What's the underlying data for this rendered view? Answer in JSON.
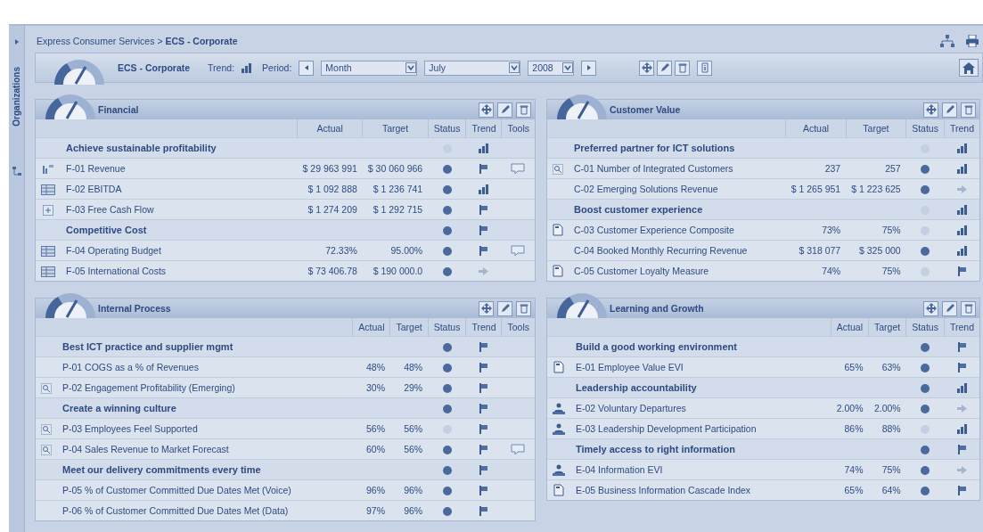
{
  "side_tab": {
    "label": "Organizations"
  },
  "breadcrumb": "Express Consumer Services > **ECS - Corporate**",
  "toolbar": {
    "title": "ECS - Corporate",
    "trend_label": "Trend:",
    "trend": {
      "kind": "up"
    },
    "period_label": "Period:",
    "selects": [
      "Month",
      "July",
      "2008"
    ]
  },
  "panels": [
    {
      "title": "Financial",
      "columns": [
        "Actual",
        "Target",
        "Status",
        "Trend",
        "Tools"
      ],
      "rows": [
        {
          "kind": "objective",
          "name": "Achieve sustainable profitability",
          "status": {
            "color": "#c3cfe2"
          },
          "trend": {
            "kind": "up"
          }
        },
        {
          "kind": "measure",
          "icon": {
            "kind": "chart"
          },
          "name": "F-01 Revenue",
          "actual": "$ 29 963 991",
          "target": "$ 30 060 966",
          "status": {
            "color": "#4a6a9e"
          },
          "trend": {
            "kind": "down"
          },
          "comment": true
        },
        {
          "kind": "measure",
          "icon": {
            "kind": "table"
          },
          "name": "F-02 EBITDA",
          "actual": "$ 1 092 888",
          "target": "$ 1 236 741",
          "status": {
            "color": "#4a6a9e"
          },
          "trend": {
            "kind": "up"
          },
          "comment": false
        },
        {
          "kind": "measure",
          "icon": {
            "kind": "plus"
          },
          "name": "F-03 Free Cash Flow",
          "actual": "$ 1 274 209",
          "target": "$ 1 292 715",
          "status": {
            "color": "#4a6a9e"
          },
          "trend": {
            "kind": "down"
          },
          "comment": false
        },
        {
          "kind": "objective",
          "name": "Competitive Cost",
          "status": {
            "color": "#4a6a9e"
          },
          "trend": {
            "kind": "down"
          }
        },
        {
          "kind": "measure",
          "icon": {
            "kind": "table"
          },
          "name": "F-04 Operating Budget",
          "actual": "72.33%",
          "target": "95.00%",
          "status": {
            "color": "#4a6a9e"
          },
          "trend": {
            "kind": "down"
          },
          "comment": true
        },
        {
          "kind": "measure",
          "icon": {
            "kind": "table"
          },
          "name": "F-05 International Costs",
          "actual": "$ 73 406.78",
          "target": "$ 190 000.0",
          "status": {
            "color": "#4a6a9e"
          },
          "trend": {
            "kind": "flat"
          },
          "comment": false
        }
      ]
    },
    {
      "title": "Customer Value",
      "columns": [
        "Actual",
        "Target",
        "Status",
        "Trend"
      ],
      "rows": [
        {
          "kind": "objective",
          "name": "Preferred partner for ICT solutions",
          "status": {
            "color": "#c3cfe2"
          },
          "trend": {
            "kind": "up"
          }
        },
        {
          "kind": "measure",
          "icon": {
            "kind": "magnifier"
          },
          "name": "C-01 Number of Integrated Customers",
          "actual": "237",
          "target": "257",
          "status": {
            "color": "#4a6a9e"
          },
          "trend": {
            "kind": "up"
          }
        },
        {
          "kind": "measure",
          "name": "C-02 Emerging Solutions Revenue",
          "actual": "$ 1 265 951",
          "target": "$ 1 223 625",
          "status": {
            "color": "#4a6a9e"
          },
          "trend": {
            "kind": "flat"
          }
        },
        {
          "kind": "objective",
          "name": "Boost customer experience",
          "status": {
            "color": "#c3cfe2"
          },
          "trend": {
            "kind": "up"
          }
        },
        {
          "kind": "measure",
          "icon": {
            "kind": "doc"
          },
          "name": "C-03 Customer Experience Composite",
          "actual": "73%",
          "target": "75%",
          "status": {
            "color": "#c3cfe2"
          },
          "trend": {
            "kind": "up"
          }
        },
        {
          "kind": "measure",
          "name": "C-04 Booked Monthly Recurring Revenue",
          "actual": "$ 318 077",
          "target": "$ 325 000",
          "status": {
            "color": "#4a6a9e"
          },
          "trend": {
            "kind": "up"
          }
        },
        {
          "kind": "measure",
          "icon": {
            "kind": "doc"
          },
          "name": "C-05 Customer Loyalty Measure",
          "actual": "74%",
          "target": "75%",
          "status": {
            "color": "#c3cfe2"
          },
          "trend": {
            "kind": "down"
          }
        }
      ]
    },
    {
      "title": "Internal Process",
      "columns": [
        "Actual",
        "Target",
        "Status",
        "Trend",
        "Tools"
      ],
      "rows": [
        {
          "kind": "objective",
          "name": "Best ICT practice and supplier mgmt",
          "status": {
            "color": "#4a6a9e"
          },
          "trend": {
            "kind": "down"
          }
        },
        {
          "kind": "measure",
          "name": "P-01 COGS as a % of Revenues",
          "actual": "48%",
          "target": "48%",
          "status": {
            "color": "#4a6a9e"
          },
          "trend": {
            "kind": "down"
          },
          "comment": false
        },
        {
          "kind": "measure",
          "icon": {
            "kind": "magnifier"
          },
          "name": "P-02 Engagement Profitability (Emerging)",
          "actual": "30%",
          "target": "29%",
          "status": {
            "color": "#4a6a9e"
          },
          "trend": {
            "kind": "down"
          },
          "comment": false
        },
        {
          "kind": "objective",
          "name": "Create a winning culture",
          "status": {
            "color": "#4a6a9e"
          },
          "trend": {
            "kind": "down"
          }
        },
        {
          "kind": "measure",
          "icon": {
            "kind": "magnifier"
          },
          "name": "P-03 Employees Feel Supported",
          "actual": "56%",
          "target": "56%",
          "status": {
            "color": "#c3cfe2"
          },
          "trend": {
            "kind": "down"
          },
          "comment": false
        },
        {
          "kind": "measure",
          "icon": {
            "kind": "magnifier"
          },
          "name": "P-04 Sales Revenue to Market Forecast",
          "actual": "60%",
          "target": "56%",
          "status": {
            "color": "#4a6a9e"
          },
          "trend": {
            "kind": "down"
          },
          "comment": true
        },
        {
          "kind": "objective",
          "name": "Meet our delivery commitments every time",
          "status": {
            "color": "#4a6a9e"
          },
          "trend": {
            "kind": "down"
          }
        },
        {
          "kind": "measure",
          "name": "P-05 % of Customer Committed Due Dates Met (Voice)",
          "actual": "96%",
          "target": "96%",
          "status": {
            "color": "#4a6a9e"
          },
          "trend": {
            "kind": "down"
          },
          "comment": false
        },
        {
          "kind": "measure",
          "name": "P-06 % of Customer Committed Due Dates Met (Data)",
          "actual": "97%",
          "target": "96%",
          "status": {
            "color": "#4a6a9e"
          },
          "trend": {
            "kind": "down"
          },
          "comment": false
        }
      ]
    },
    {
      "title": "Learning and Growth",
      "columns": [
        "Actual",
        "Target",
        "Status",
        "Trend"
      ],
      "rows": [
        {
          "kind": "objective",
          "name": "Build a good working environment",
          "status": {
            "color": "#4a6a9e"
          },
          "trend": {
            "kind": "down"
          }
        },
        {
          "kind": "measure",
          "icon": {
            "kind": "doc"
          },
          "name": "E-01 Employee Value EVI",
          "actual": "65%",
          "target": "63%",
          "status": {
            "color": "#4a6a9e"
          },
          "trend": {
            "kind": "down"
          }
        },
        {
          "kind": "objective",
          "name": "Leadership accountability",
          "status": {
            "color": "#4a6a9e"
          },
          "trend": {
            "kind": "up"
          }
        },
        {
          "kind": "measure",
          "icon": {
            "kind": "people"
          },
          "name": "E-02 Voluntary Departures",
          "actual": "2.00%",
          "target": "2.00%",
          "status": {
            "color": "#4a6a9e"
          },
          "trend": {
            "kind": "flat"
          }
        },
        {
          "kind": "measure",
          "icon": {
            "kind": "people"
          },
          "name": "E-03 Leadership Development Participation",
          "actual": "86%",
          "target": "88%",
          "status": {
            "color": "#c3cfe2"
          },
          "trend": {
            "kind": "up"
          }
        },
        {
          "kind": "objective",
          "name": "Timely access to right information",
          "status": {
            "color": "#4a6a9e"
          },
          "trend": {
            "kind": "down"
          }
        },
        {
          "kind": "measure",
          "icon": {
            "kind": "people"
          },
          "name": "E-04 Information EVI",
          "actual": "74%",
          "target": "75%",
          "status": {
            "color": "#4a6a9e"
          },
          "trend": {
            "kind": "flat"
          }
        },
        {
          "kind": "measure",
          "icon": {
            "kind": "doc"
          },
          "name": "E-05 Business Information Cascade Index",
          "actual": "65%",
          "target": "64%",
          "status": {
            "color": "#4a6a9e"
          },
          "trend": {
            "kind": "down"
          }
        }
      ]
    }
  ]
}
